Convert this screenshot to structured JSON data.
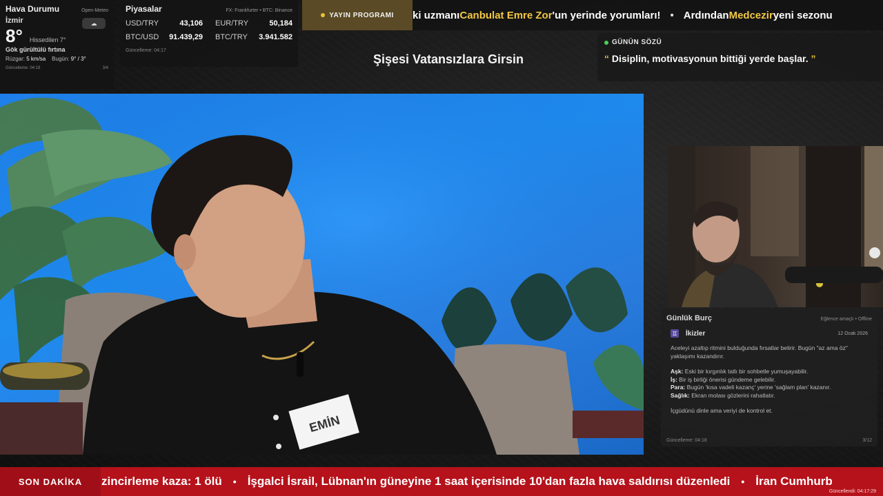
{
  "weather": {
    "title": "Hava Durumu",
    "source": "Open-Meteo",
    "city": "İzmir",
    "temperature": "8°",
    "feels_like": "Hissedilen 7°",
    "condition": "Gök gürültülü fırtına",
    "wind_label": "Rüzgar:",
    "wind_value": "5 km/sa",
    "today_label": "Bugün:",
    "today_value": "9° / 3°",
    "updated": "Güncelleme: 04:18",
    "page": "3/4",
    "icon": "cloud-icon"
  },
  "markets": {
    "title": "Piyasalar",
    "source": "FX: Frankfurter • BTC: Binance",
    "rows": [
      {
        "symbol": "USD/TRY",
        "value": "43,106"
      },
      {
        "symbol": "EUR/TRY",
        "value": "50,184"
      },
      {
        "symbol": "BTC/USD",
        "value": "91.439,29"
      },
      {
        "symbol": "BTC/TRY",
        "value": "3.941.582"
      }
    ],
    "updated": "Güncelleme: 04:17"
  },
  "ticker": {
    "schedule_label": "YAYIN PROGRAMI",
    "part1": "ki uzmanı ",
    "highlight1": "Canbulat Emre Zor",
    "part2": "'un yerinde yorumları!",
    "separator": "•",
    "part3": "Ardından ",
    "highlight2": "Medcezir",
    "part4": " yeni sezonu"
  },
  "show_title": "Şişesi Vatansızlara Girsin",
  "quote": {
    "label": "GÜNÜN SÖZÜ",
    "open_mark": "“",
    "text": "Disiplin, motivasyonun bittiği yerde başlar.",
    "close_mark": "”"
  },
  "video": {
    "name_tag": "EMİN"
  },
  "horoscope": {
    "title": "Günlük Burç",
    "note": "Eğlence amaçlı • Offline",
    "sign_symbol": "♊",
    "sign": "İkizler",
    "date": "12 Ocak 2026",
    "intro": "Aceleyi azaltıp ritmini bulduğunda fırsatlar belirir. Bugün \"az ama öz\" yaklaşımı kazandırır.",
    "lines": [
      {
        "key": "Aşk:",
        "text": " Eski bir kırgınlık tatlı bir sohbetle yumuşayabilir."
      },
      {
        "key": "İş:",
        "text": " Bir iş birliği önerisi gündeme gelebilir."
      },
      {
        "key": "Para:",
        "text": " Bugün 'kısa vadeli kazanç' yerine 'sağlam plan' kazanır."
      },
      {
        "key": "Sağlık:",
        "text": " Ekran molası gözlerini rahatlatır."
      }
    ],
    "closing": "İçgüdünü dinle ama veriyi de kontrol et.",
    "updated": "Güncelleme: 04:18",
    "page": "3/12"
  },
  "breaking": {
    "label": "SON DAKİKA",
    "items": [
      "zincirleme kaza: 1 ölü",
      "İşgalci İsrail, Lübnan'ın güneyine 1 saat içerisinde 10'dan fazla hava saldırısı düzenledi",
      "İran Cumhurb"
    ],
    "separator": "•",
    "updated": "Güncellendi: 04:17:29"
  },
  "colors": {
    "accent_gold": "#f2c744",
    "breaking_red": "#b5121b",
    "status_green": "#4ccf5a",
    "video_blue": "#1f8cf0"
  }
}
